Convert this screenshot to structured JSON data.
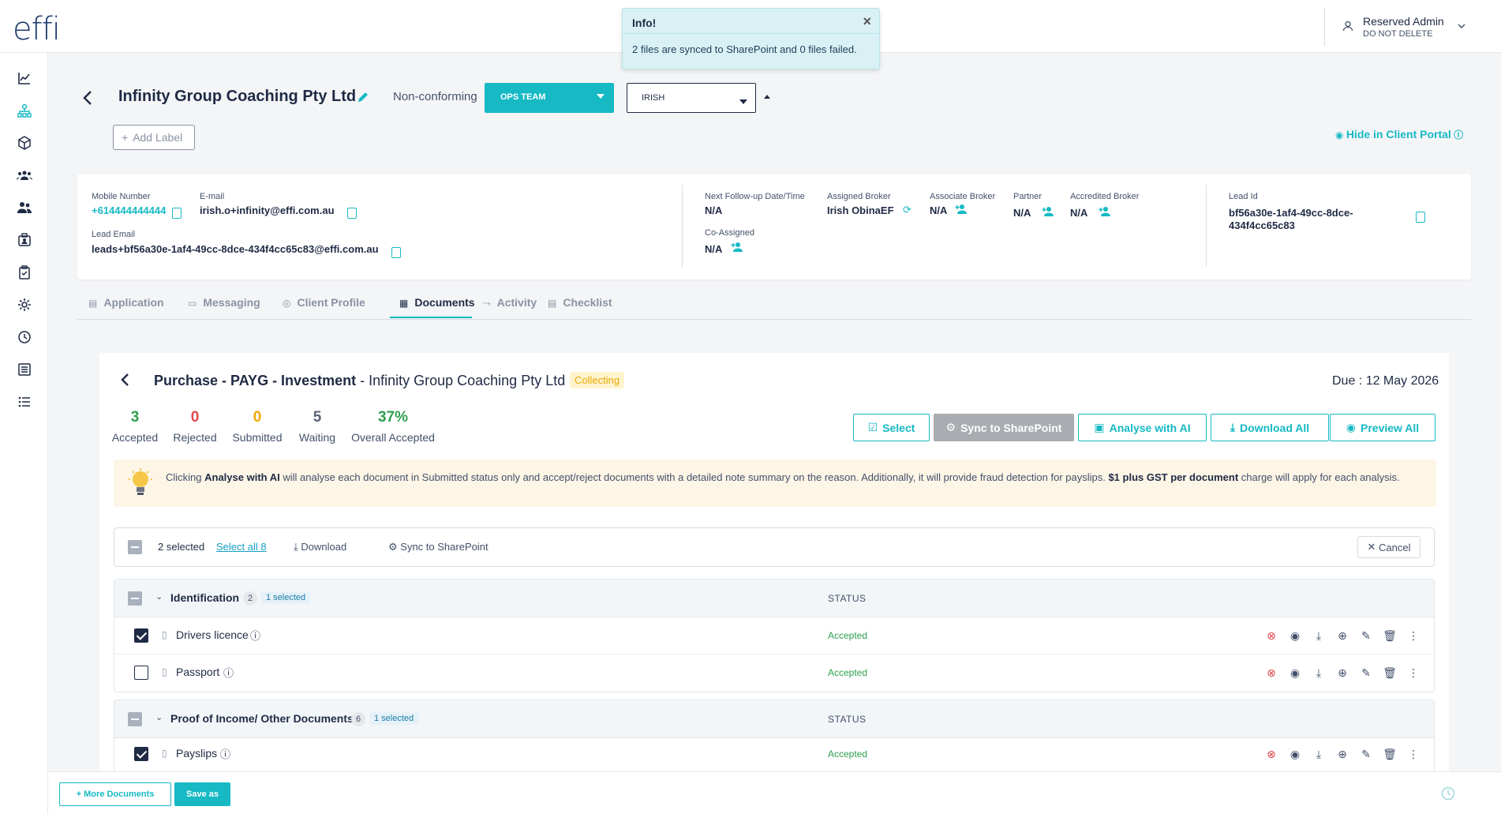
{
  "header": {
    "logo": "effi",
    "user_name": "Reserved Admin",
    "user_sub": "DO NOT DELETE"
  },
  "toast": {
    "title": "Info!",
    "message": "2 files are synced to SharePoint and 0 files failed."
  },
  "sidebar": {
    "icons": [
      "chart-icon",
      "org-chart-icon",
      "box-icon",
      "group-icon",
      "users-icon",
      "badge-icon",
      "clipboard-check-icon",
      "settings-icon",
      "refresh-circle-icon",
      "list-alt-icon",
      "list-icon"
    ],
    "active_index": 1
  },
  "lead": {
    "title": "Infinity Group Coaching Pty Ltd",
    "status_label": "Non-conforming",
    "team": "OPS TEAM",
    "assignee": "IRISH",
    "add_label": "Add Label",
    "hide_portal": "Hide in Client Portal"
  },
  "info": {
    "mobile_label": "Mobile Number",
    "mobile": "+614444444444",
    "email_label": "E-mail",
    "email": "irish.o+infinity@effi.com.au",
    "lead_email_label": "Lead Email",
    "lead_email": "leads+bf56a30e-1af4-49cc-8dce-434f4cc65c83@effi.com.au",
    "followup_label": "Next Follow-up Date/Time",
    "followup": "N/A",
    "assigned_label": "Assigned Broker",
    "assigned": "Irish ObinaEF",
    "associate_label": "Associate Broker",
    "associate": "N/A",
    "partner_label": "Partner",
    "partner": "N/A",
    "accredited_label": "Accredited Broker",
    "accredited": "N/A",
    "coassigned_label": "Co-Assigned",
    "coassigned": "N/A",
    "leadid_label": "Lead Id",
    "leadid_1": "bf56a30e-1af4-49cc-8dce-",
    "leadid_2": "434f4cc65c83"
  },
  "tabs": [
    "Application",
    "Messaging",
    "Client Profile",
    "Documents",
    "Activity",
    "Checklist"
  ],
  "docs": {
    "title_bold": "Purchase - PAYG - Investment",
    "title_rest": " - Infinity Group Coaching Pty Ltd",
    "badge": "Collecting",
    "due": "Due : 12 May 2026",
    "stats": [
      {
        "num": "3",
        "label": "Accepted",
        "color": "#2e9e4f"
      },
      {
        "num": "0",
        "label": "Rejected",
        "color": "#e0474c"
      },
      {
        "num": "0",
        "label": "Submitted",
        "color": "#f0a500"
      },
      {
        "num": "5",
        "label": "Waiting",
        "color": "#5a6476"
      },
      {
        "num": "37%",
        "label": "Overall Accepted",
        "color": "#2e9e4f"
      }
    ],
    "buttons": {
      "select": "Select",
      "sync": "Sync to SharePoint",
      "analyse": "Analyse with AI",
      "download_all": "Download All",
      "preview_all": "Preview All"
    },
    "notice": {
      "pre": "Clicking ",
      "bold1": "Analyse with AI",
      "mid": " will analyse each document in Submitted status only and accept/reject documents with a detailed note summary on the reason. Additionally, it will provide fraud detection for payslips. ",
      "bold2": "$1 plus GST per document",
      "post": " charge will apply for each analysis."
    },
    "selection": {
      "count": "2 selected",
      "select_all": "Select all 8",
      "download": "Download",
      "sync": "Sync to SharePoint",
      "cancel": "Cancel"
    },
    "groups": [
      {
        "title": "Identification",
        "count": "2",
        "selected": "1 selected",
        "status_head": "STATUS",
        "rows": [
          {
            "name": "Drivers licence",
            "status": "Accepted",
            "checked": true
          },
          {
            "name": "Passport",
            "status": "Accepted",
            "checked": false
          }
        ]
      },
      {
        "title": "Proof of Income/ Other Documents",
        "count": "6",
        "selected": "1 selected",
        "status_head": "STATUS",
        "rows": [
          {
            "name": "Payslips",
            "status": "Accepted",
            "checked": true
          }
        ]
      }
    ]
  },
  "footer": {
    "more": "+ More Documents",
    "saveas": "Save as"
  }
}
